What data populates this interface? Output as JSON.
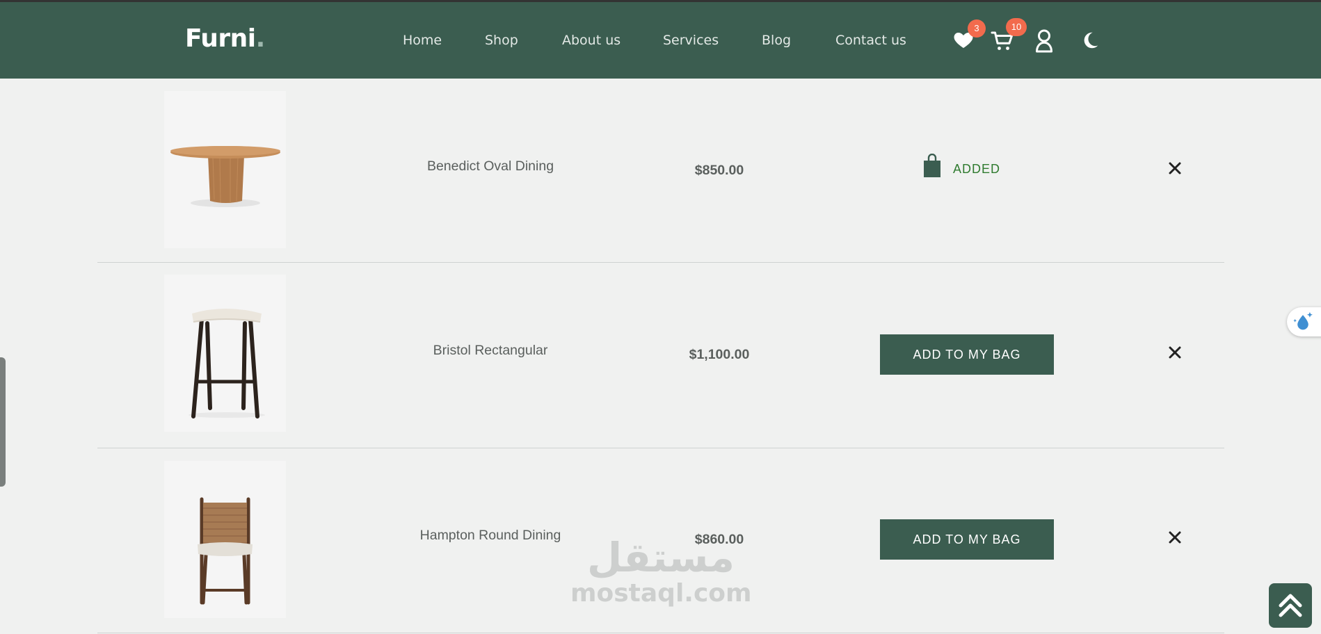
{
  "brand": {
    "name": "Furni",
    "dot": "."
  },
  "nav": {
    "home": "Home",
    "shop": "Shop",
    "about": "About us",
    "services": "Services",
    "blog": "Blog",
    "contact": "Contact us"
  },
  "header_icons": {
    "wishlist_icon": "heart-icon",
    "wishlist_count": "3",
    "cart_icon": "cart-icon",
    "cart_count": "10",
    "user_icon": "user-icon",
    "theme_icon": "moon-icon"
  },
  "wishlist": [
    {
      "name": "Benedict Oval Dining",
      "price": "$850.00",
      "status": "ADDED",
      "status_icon": "bag-icon"
    },
    {
      "name": "Bristol Rectangular",
      "price": "$1,100.00",
      "action": "ADD TO MY BAG"
    },
    {
      "name": "Hampton Round Dining",
      "price": "$860.00",
      "action": "ADD TO MY BAG"
    }
  ],
  "watermark": {
    "arabic": "مستقل",
    "latin": "mostaql.com"
  },
  "colors": {
    "header_bg": "#3b5d50",
    "page_bg": "#f0f1f0",
    "badge": "#f26b4d",
    "added_green": "#2f7b2f"
  }
}
